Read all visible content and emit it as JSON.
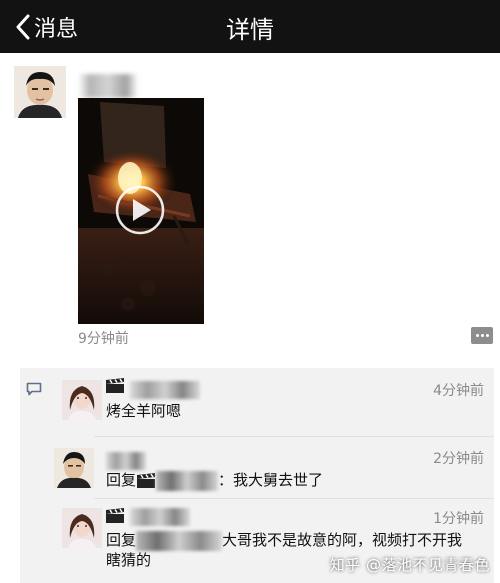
{
  "header": {
    "back_label": "消息",
    "title": "详情"
  },
  "post": {
    "time": "9分钟前"
  },
  "comments": [
    {
      "text": "烤全羊阿嗯",
      "time": "4分钟前"
    },
    {
      "prefix": "回复",
      "text": "：我大舅去世了",
      "time": "2分钟前"
    },
    {
      "prefix": "回复",
      "text": "大哥我不是故意的阿，视频打不开我",
      "text2": "瞎猜的",
      "time": "1分钟前"
    }
  ],
  "watermark": "知乎 @落池不见青春色",
  "colors": {
    "topbar": "#121212",
    "comment_bg": "#f2f2f2",
    "meta_text": "#8a8a8a"
  },
  "icons": [
    "chevron-left-icon",
    "play-icon",
    "more-icon",
    "comment-icon",
    "clapperboard-icon"
  ]
}
